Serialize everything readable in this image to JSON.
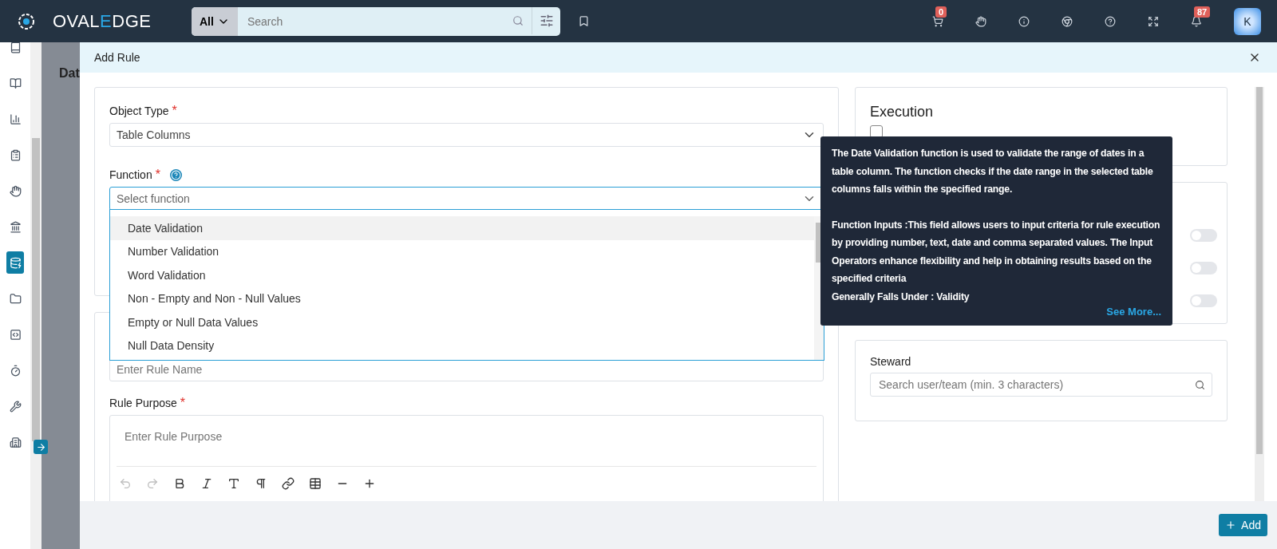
{
  "topbar": {
    "logo": [
      {
        "text": "OVAL",
        "accent": false
      },
      {
        "text": "E",
        "accent": true
      },
      {
        "text": "DGE",
        "accent": false
      }
    ],
    "search": {
      "scope": "All",
      "placeholder": "Search"
    },
    "actions": [
      {
        "kind": "cart",
        "badge": "0"
      },
      {
        "kind": "hand"
      },
      {
        "kind": "info"
      },
      {
        "kind": "chrome"
      },
      {
        "kind": "help"
      },
      {
        "kind": "expand"
      },
      {
        "kind": "bell",
        "badge": "87"
      }
    ],
    "avatar": "K"
  },
  "sidebar": {
    "items": [
      {
        "kind": "book",
        "selected": false
      },
      {
        "kind": "book-open",
        "selected": false
      },
      {
        "kind": "chart",
        "selected": false
      },
      {
        "kind": "clipboard",
        "selected": false
      },
      {
        "kind": "hand",
        "selected": false
      },
      {
        "kind": "bank",
        "selected": false
      },
      {
        "kind": "database",
        "selected": true
      },
      {
        "kind": "folder",
        "selected": false
      },
      {
        "kind": "code",
        "selected": false
      },
      {
        "kind": "timer",
        "selected": false
      },
      {
        "kind": "tools",
        "selected": false
      },
      {
        "kind": "building",
        "selected": false
      }
    ]
  },
  "background_page": {
    "title": "Dat"
  },
  "modal": {
    "title": "Add Rule",
    "object_type": {
      "label": "Object Type",
      "marker": "*",
      "value": "Table Columns"
    },
    "function": {
      "label": "Function",
      "marker": "*",
      "placeholder": "Select function",
      "options": [
        {
          "label": "Date Validation",
          "selected": true
        },
        {
          "label": "Number Validation",
          "selected": false
        },
        {
          "label": "Word Validation",
          "selected": false
        },
        {
          "label": "Non - Empty and Non - Null Values",
          "selected": false
        },
        {
          "label": "Empty or Null Data Values",
          "selected": false
        },
        {
          "label": "Null Data Density",
          "selected": false
        }
      ]
    },
    "rule_name": {
      "placeholder": "Enter Rule Name"
    },
    "rule_purpose": {
      "label": "Rule Purpose",
      "marker": "*",
      "placeholder": "Enter Rule Purpose",
      "toolbar": [
        {
          "kind": "undo",
          "disabled": true
        },
        {
          "kind": "redo",
          "disabled": true
        },
        {
          "kind": "bold",
          "disabled": false
        },
        {
          "kind": "italic",
          "disabled": false
        },
        {
          "kind": "font",
          "disabled": false
        },
        {
          "kind": "paragraph",
          "disabled": false
        },
        {
          "kind": "link",
          "disabled": false
        },
        {
          "kind": "table",
          "disabled": false
        },
        {
          "kind": "rule",
          "disabled": false
        },
        {
          "kind": "more",
          "disabled": false
        }
      ]
    },
    "execution": {
      "title": "Execution",
      "schedule_checked": false
    },
    "toggles": [
      {
        "on": false
      },
      {
        "on": false
      },
      {
        "on": false
      }
    ],
    "steward": {
      "label": "Steward",
      "placeholder": "Search user/team (min. 3 characters)"
    },
    "tooltip": {
      "paragraphs": [
        "The Date Validation function is used to validate the range of dates in a table column. The function checks if the date range in the selected table columns falls within the specified range.",
        "Function Inputs :This field allows users to input criteria for rule execution by providing number, text, date and comma separated values. The Input Operators enhance flexibility and help in obtaining results based on the specified criteria",
        "Generally Falls Under : Validity"
      ],
      "link": "See More..."
    },
    "add_button": "Add"
  }
}
